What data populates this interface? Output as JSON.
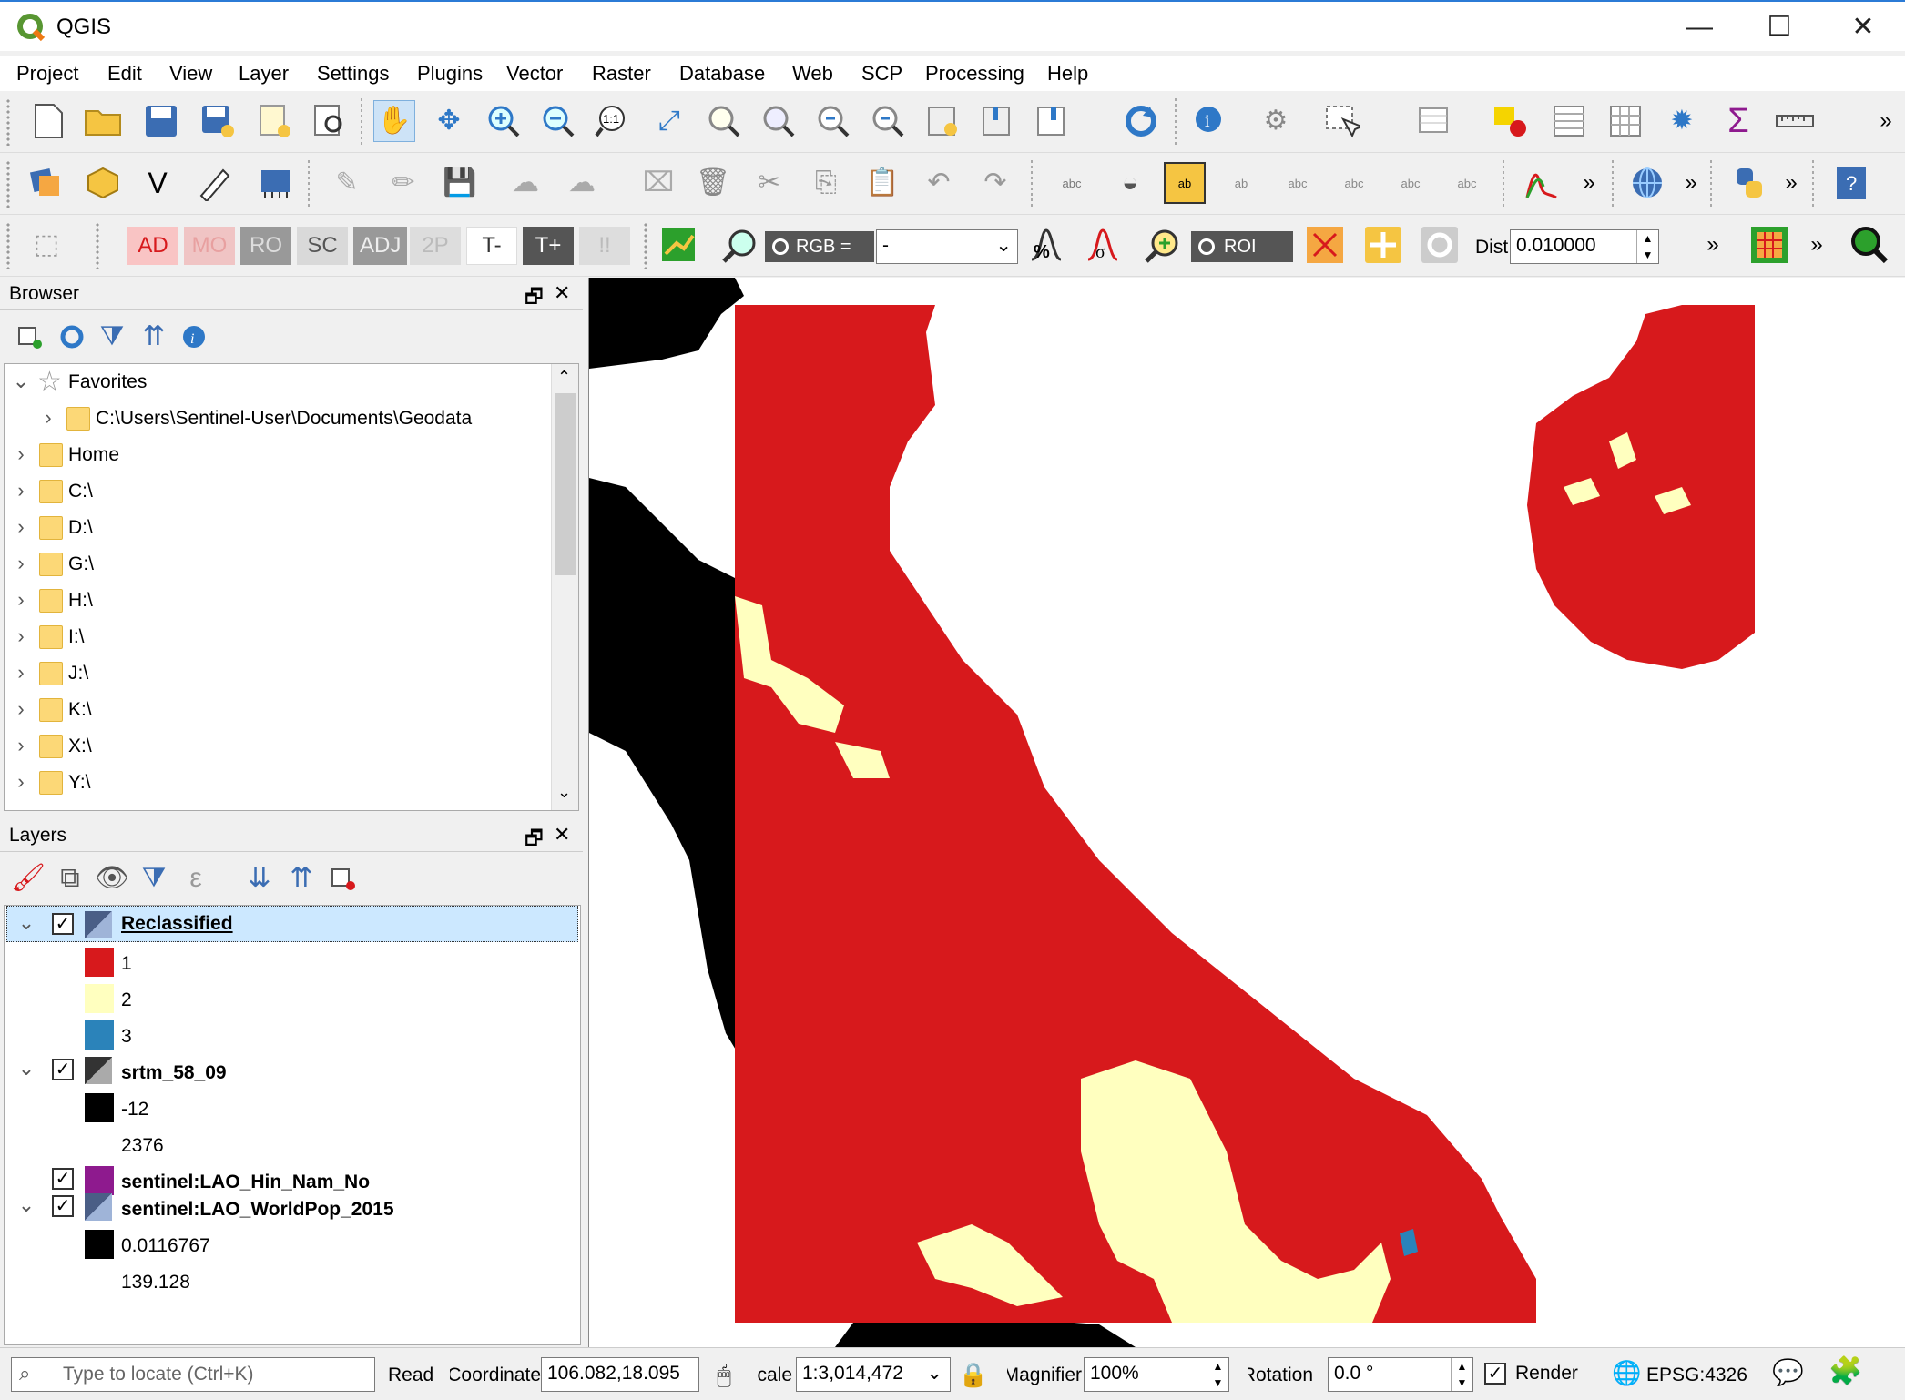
{
  "window": {
    "title": "QGIS",
    "minimize": "—",
    "maximize": "☐",
    "close": "✕"
  },
  "menu": [
    "Project",
    "Edit",
    "View",
    "Layer",
    "Settings",
    "Plugins",
    "Vector",
    "Raster",
    "Database",
    "Web",
    "SCP",
    "Processing",
    "Help"
  ],
  "toolbar": {
    "overflow": "»",
    "scp_chips": [
      "AD",
      "MO",
      "RO",
      "SC",
      "ADJ",
      "2P",
      "T-",
      "T+",
      "!!"
    ],
    "rgb_label": "RGB =",
    "rgb_value": "-",
    "roi_label": "ROI",
    "dist_label": "Dist",
    "dist_value": "0.010000"
  },
  "browser": {
    "title": "Browser",
    "items": [
      {
        "label": "Favorites",
        "indent": 0,
        "icon": "star-icon",
        "expanded": true
      },
      {
        "label": "C:\\Users\\Sentinel-User\\Documents\\Geodata",
        "indent": 1,
        "icon": "folder-icon",
        "expanded": false
      },
      {
        "label": "Home",
        "indent": 0,
        "icon": "folder-icon",
        "expanded": false
      },
      {
        "label": "C:\\",
        "indent": 0,
        "icon": "folder-icon",
        "expanded": false
      },
      {
        "label": "D:\\",
        "indent": 0,
        "icon": "folder-icon",
        "expanded": false
      },
      {
        "label": "G:\\",
        "indent": 0,
        "icon": "folder-icon",
        "expanded": false
      },
      {
        "label": "H:\\",
        "indent": 0,
        "icon": "folder-icon",
        "expanded": false
      },
      {
        "label": "I:\\",
        "indent": 0,
        "icon": "folder-icon",
        "expanded": false
      },
      {
        "label": "J:\\",
        "indent": 0,
        "icon": "folder-icon",
        "expanded": false
      },
      {
        "label": "K:\\",
        "indent": 0,
        "icon": "folder-icon",
        "expanded": false
      },
      {
        "label": "X:\\",
        "indent": 0,
        "icon": "folder-icon",
        "expanded": false
      },
      {
        "label": "Y:\\",
        "indent": 0,
        "icon": "folder-icon",
        "expanded": false
      }
    ]
  },
  "layers": {
    "title": "Layers",
    "reclassified": {
      "name": "Reclassified",
      "entries": [
        {
          "label": "1",
          "color": "#d7191c"
        },
        {
          "label": "2",
          "color": "#ffffbf"
        },
        {
          "label": "3",
          "color": "#2b83ba"
        }
      ]
    },
    "srtm": {
      "name": "srtm_58_09",
      "min": "-12",
      "max": "2376"
    },
    "hin_nam_no": {
      "name": "sentinel:LAO_Hin_Nam_No",
      "color": "#8e1a8e"
    },
    "worldpop": {
      "name": "sentinel:LAO_WorldPop_2015",
      "min": "0.0116767",
      "max": "139.128"
    }
  },
  "status": {
    "locate_placeholder": "Type to locate (Ctrl+K)",
    "ready": "Read",
    "coordinate_label": "Coordinate",
    "coordinate": "106.082,18.095",
    "scale_label": "Scale",
    "scale": "1:3,014,472",
    "magnifier_label": "Magnifier",
    "magnifier": "100%",
    "rotation_label": "Rotation",
    "rotation": "0.0 °",
    "render": "Render",
    "crs": "EPSG:4326"
  },
  "colors": {
    "class1": "#d7191c",
    "class2": "#ffffbf",
    "class3": "#2b83ba",
    "nodata": "#000000"
  }
}
